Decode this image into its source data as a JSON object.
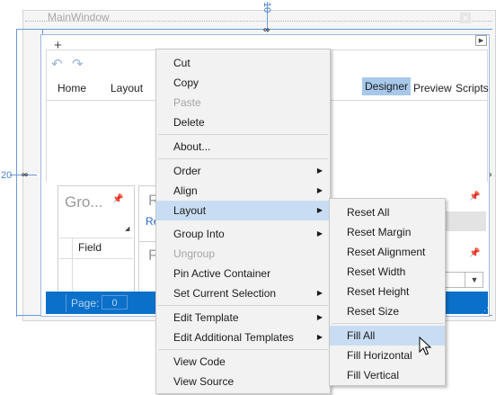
{
  "window": {
    "title": "MainWindow",
    "guide_top_value": "10",
    "guide_left_value": "20"
  },
  "ribbon": {
    "tabs": [
      "Home",
      "Layout"
    ],
    "right_tabs": [
      "Designer",
      "Preview",
      "Scripts"
    ],
    "active_tab": "Designer"
  },
  "panels": {
    "group_title": "Gro...",
    "field_header": "Field",
    "r_title": "R",
    "r_link": "Re",
    "p_title": "P"
  },
  "status_bar": {
    "page_label": "Page:",
    "page_value": "0"
  },
  "context_menu": {
    "items": [
      {
        "label": "Cut",
        "enabled": true
      },
      {
        "label": "Copy",
        "enabled": true
      },
      {
        "label": "Paste",
        "enabled": false
      },
      {
        "label": "Delete",
        "enabled": true
      },
      {
        "label": "About...",
        "enabled": true
      },
      {
        "label": "Order",
        "enabled": true,
        "submenu": true
      },
      {
        "label": "Align",
        "enabled": true,
        "submenu": true
      },
      {
        "label": "Layout",
        "enabled": true,
        "submenu": true,
        "highlighted": true
      },
      {
        "label": "Group Into",
        "enabled": true,
        "submenu": true
      },
      {
        "label": "Ungroup",
        "enabled": false
      },
      {
        "label": "Pin Active Container",
        "enabled": true
      },
      {
        "label": "Set Current Selection",
        "enabled": true,
        "submenu": true
      },
      {
        "label": "Edit Template",
        "enabled": true,
        "submenu": true
      },
      {
        "label": "Edit Additional Templates",
        "enabled": true,
        "submenu": true
      },
      {
        "label": "View Code",
        "enabled": true
      },
      {
        "label": "View Source",
        "enabled": true
      }
    ]
  },
  "layout_submenu": {
    "items": [
      {
        "label": "Reset All"
      },
      {
        "label": "Reset Margin"
      },
      {
        "label": "Reset Alignment"
      },
      {
        "label": "Reset Width"
      },
      {
        "label": "Reset Height"
      },
      {
        "label": "Reset Size"
      },
      {
        "label": "Fill All",
        "highlighted": true
      },
      {
        "label": "Fill Horizontal"
      },
      {
        "label": "Fill Vertical"
      }
    ]
  },
  "colors": {
    "accent": "#0b70c9",
    "menu_highlight": "#c8ddf3",
    "guide": "#6a9ad8",
    "designer_tab": "#a8c8ea"
  }
}
